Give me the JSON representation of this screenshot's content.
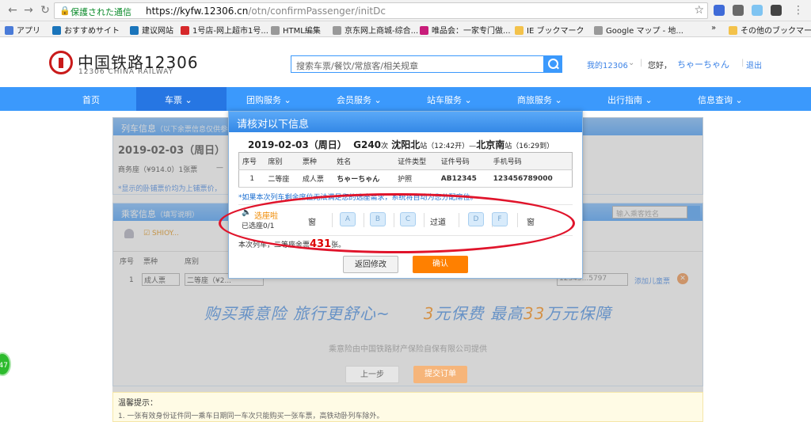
{
  "browser": {
    "secure_label": "保護された通信",
    "url_host": "https://kyfw.12306.cn",
    "url_path": "/otn/confirmPassenger/initDc",
    "bookmarks": [
      {
        "label": "アプリ",
        "color": "#4a7bd8"
      },
      {
        "label": "おすすめサイト",
        "color": "#1b75bb"
      },
      {
        "label": "建议网站",
        "color": "#1b75bb"
      },
      {
        "label": "1号店-网上超市1号...",
        "color": "#d6282a"
      },
      {
        "label": "HTML編集",
        "color": "#999999"
      },
      {
        "label": "京东网上商城-综合...",
        "color": "#999999"
      },
      {
        "label": "唯品会：一家专门做...",
        "color": "#c81d7a"
      },
      {
        "label": "IE ブックマーク",
        "color": "#f3c24b"
      },
      {
        "label": "Google マップ - 地...",
        "color": "#999999"
      },
      {
        "label": "»",
        "color": ""
      },
      {
        "label": "その他のブックマーク",
        "color": "#f3c24b"
      }
    ]
  },
  "header": {
    "logo_cn": "中国铁路12306",
    "logo_en": "12306 CHINA RAILWAY",
    "search_placeholder": "搜索车票/餐饮/常旅客/相关规章",
    "my12306": "我的12306",
    "greeting": "您好，",
    "username": "ちゃーちゃん",
    "logout": "退出"
  },
  "nav": [
    "首页",
    "车票",
    "团购服务",
    "会员服务",
    "站车服务",
    "商旅服务",
    "出行指南",
    "信息查询"
  ],
  "train_panel": {
    "title": "列车信息",
    "subtitle": "（以下余票信息仅供参考）",
    "date": "2019-02-03（周日）",
    "seat_info": "商务座（¥914.0）1张票",
    "dash": "—",
    "note": "*显示的卧铺票价均为上铺票价，"
  },
  "passenger_panel": {
    "title": "乘客信息",
    "subtitle": "（填写说明）",
    "search_placeholder": "输入乘客姓名",
    "passenger_chip": "SHIOY...",
    "headers": [
      "序号",
      "票种",
      "席别"
    ],
    "row_index": "1",
    "ticket_type": "成人票",
    "seat_class": "二等座（¥2...",
    "phone_partial": "12345...5797",
    "add_child": "添加儿童票"
  },
  "insurance": {
    "line_a": "购买乘意险 旅行更舒心~",
    "line_b_pre": "3",
    "line_b_mid": "元保费 最高",
    "line_b_num": "33",
    "line_b_post": "万元保障",
    "sub": "乘意险由中国铁路财产保险自保有限公司提供"
  },
  "buttons": {
    "prev": "上一步",
    "submit": "提交订单"
  },
  "tips": {
    "title": "温馨提示：",
    "line1": "1. 一张有效身份证件同一乘车日期同一车次只能购买一张车票，高铁动卧列车除外。"
  },
  "side_badge": "47",
  "modal": {
    "title": "请核对以下信息",
    "train_date": "2019-02-03（周日）",
    "train_no": "G240",
    "train_no_suffix": "次",
    "from": "沈阳北",
    "from_suffix": "站（12:42开）—",
    "to": "北京南",
    "to_suffix": "站",
    "arrive": "（16:29到）",
    "table_headers": [
      "序号",
      "席别",
      "票种",
      "姓名",
      "证件类型",
      "证件号码",
      "手机号码"
    ],
    "row": [
      "1",
      "二等座",
      "成人票",
      "ちゃーちゃん",
      "护照",
      "AB12345",
      "123456789000"
    ],
    "notice": "*如果本次列车剩余席位无法满足您的选座需求，系统将自动为您分配席位。",
    "seat_label": "选座啦",
    "seat_count": "已选座0/1",
    "window_left": "窗",
    "aisle": "过道",
    "window_right": "窗",
    "seats": [
      "A",
      "B",
      "C",
      "D",
      "F"
    ],
    "remain_pre": "本次列车，二等座余票",
    "remain_num": "431",
    "remain_post": "张。",
    "back_label": "返回修改",
    "confirm_label": "确认"
  }
}
